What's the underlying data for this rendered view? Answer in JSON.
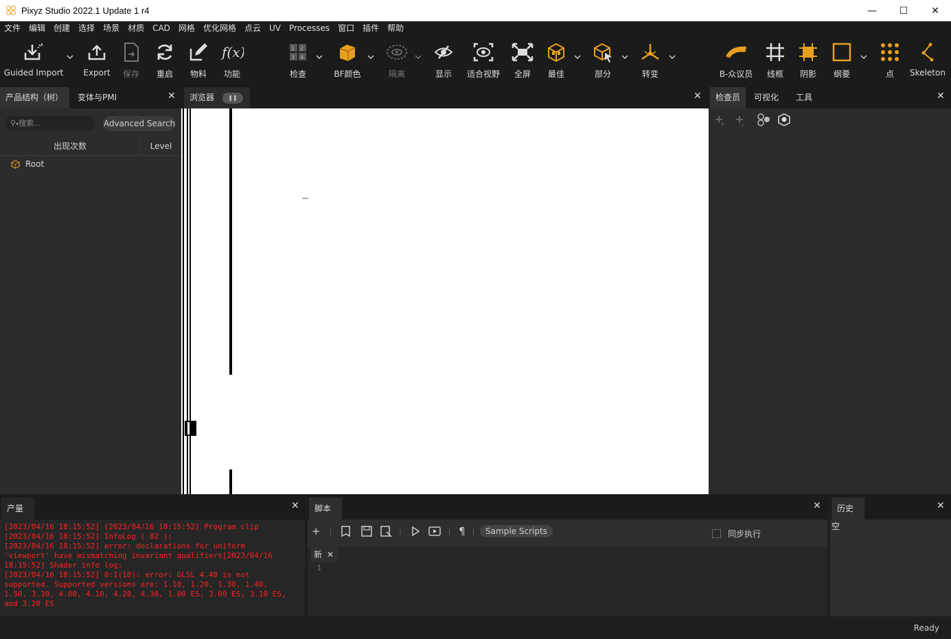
{
  "window": {
    "title": "Pixyz Studio 2022.1 Update 1 r4",
    "minimize": "—",
    "maximize": "☐",
    "close": "✕"
  },
  "menu": [
    "文件",
    "编辑",
    "创建",
    "选择",
    "场景",
    "材质",
    "CAD",
    "网格",
    "优化网格",
    "点云",
    "UV",
    "Processes",
    "窗口",
    "插件",
    "帮助"
  ],
  "toolbar": {
    "guided_import": "Guided Import",
    "export": "Export",
    "save": "保存",
    "restart": "重启",
    "material": "物料",
    "function": "功能",
    "inspect": "检查",
    "bf_color": "BF颜色",
    "isolate": "隔离",
    "show": "显示",
    "fit_view": "适合视野",
    "fullscreen": "全屏",
    "best": "最佳",
    "part": "部分",
    "transform": "转变",
    "b_rep": "B-众议员",
    "wireframe": "线框",
    "shadow": "阴影",
    "outline": "纲要",
    "points": "点",
    "skeleton": "Skeleton"
  },
  "left_panel": {
    "tab_tree": "产品结构（树）",
    "tab_pmi": "变体与PMI",
    "search_placeholder": "搜索...",
    "advanced_search": "Advanced Search",
    "col_occurrence": "出现次数",
    "col_level": "Level",
    "root": "Root"
  },
  "viewport": {
    "tab": "浏览器"
  },
  "right_panel": {
    "tab_inspector": "检查员",
    "tab_visualize": "可视化",
    "tab_tools": "工具"
  },
  "output": {
    "tab": "产量",
    "log": "[2023/04/16 18:15:52] [2023/04/16 18:15:52] Program clip\n[2023/04/16 18:15:52] InfoLog ( 82 ):\n[2023/04/16 18:15:52] error: declarations for uniform\n`viewport' have mismatching invariant qualifiers[2023/04/16\n18:15:52] Shader info log:\n[2023/04/16 18:15:52] 0:1(10): error: GLSL 4.40 is not\nsupported. Supported versions are: 1.10, 1.20, 1.30, 1.40,\n1.50, 3.30, 4.00, 4.10, 4.20, 4.30, 1.00 ES, 3.00 ES, 3.10 ES,\nand 3.20 ES"
  },
  "script": {
    "tab": "脚本",
    "sample_scripts": "Sample Scripts",
    "sync_exec": "同步执行",
    "new_tab": "新",
    "line1": "1"
  },
  "history": {
    "tab": "历史",
    "empty": "空"
  },
  "status": {
    "text": "Ready"
  },
  "colors": {
    "accent": "#e8a020",
    "log_error": "#ff2020",
    "background": "#1e1e1e"
  }
}
